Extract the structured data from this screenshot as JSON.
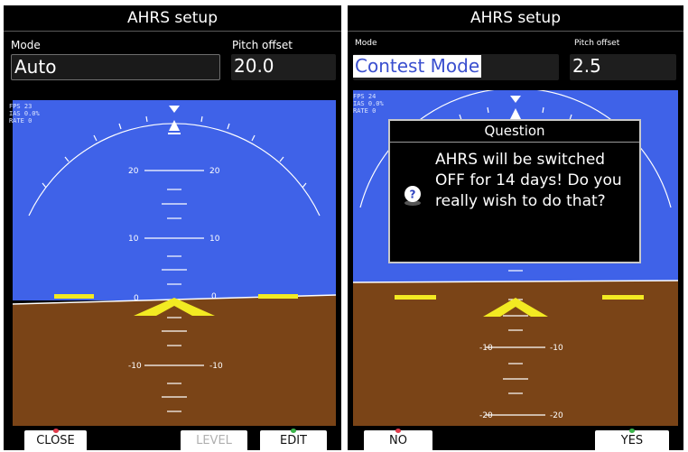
{
  "left": {
    "title": "AHRS setup",
    "mode": {
      "label": "Mode",
      "value": "Auto"
    },
    "pitch_offset": {
      "label": "Pitch offset",
      "value": "20.0"
    },
    "info": [
      "FPS 23",
      "IAS 0.0%",
      "RATE 0"
    ],
    "pitch_ladder": {
      "p20": "20",
      "p10": "10",
      "p0": "0",
      "m10": "-10"
    },
    "softkeys": {
      "close": "CLOSE",
      "level": "LEVEL",
      "edit": "EDIT"
    }
  },
  "right": {
    "title": "AHRS setup",
    "mode": {
      "label": "Mode",
      "value": "Contest Mode"
    },
    "pitch_offset": {
      "label": "Pitch offset",
      "value": "2.5"
    },
    "info": [
      "FPS 24",
      "IAS 0.0%",
      "RATE 0"
    ],
    "pitch_ladder": {
      "m10": "-10",
      "m20": "-20"
    },
    "dialog": {
      "title": "Question",
      "message": "AHRS will be switched OFF for 14 days! Do you really wish to do that?"
    },
    "softkeys": {
      "no": "NO",
      "yes": "YES"
    }
  },
  "colors": {
    "sky": "#3f62e8",
    "ground": "#7a4417",
    "aircraft_symbol": "#f2ea22",
    "highlight_text": "#3a4fcf",
    "dot_red": "#e03a4a",
    "dot_green": "#3ab44a"
  },
  "icons": {
    "question": "question-icon",
    "sky_pointer": "sky-pointer-icon",
    "aircraft": "aircraft-symbol-icon"
  }
}
